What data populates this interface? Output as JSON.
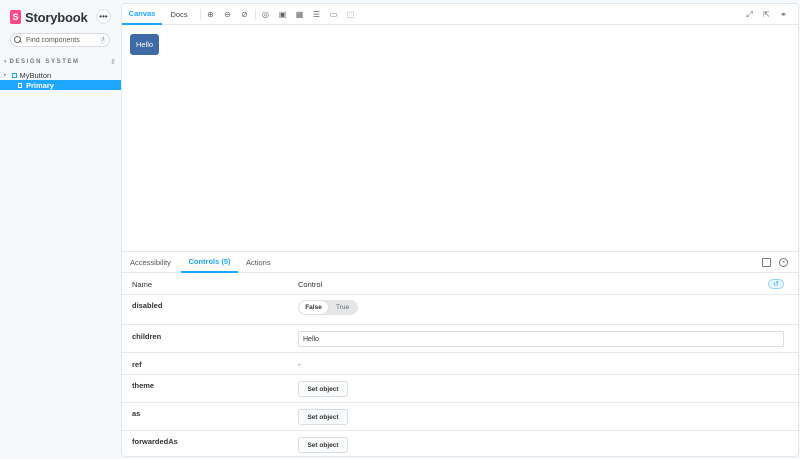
{
  "sidebar": {
    "brand": "Storybook",
    "logo_letter": "S",
    "menu_icon": "ellipsis-icon",
    "search": {
      "placeholder": "Find components",
      "shortcut": "/"
    },
    "group": {
      "label": "DESIGN SYSTEM"
    },
    "component": "MyButton",
    "story": "Primary",
    "accent": "#1ea7fd"
  },
  "toolbar": {
    "tabs": [
      {
        "label": "Canvas"
      },
      {
        "label": "Docs"
      }
    ],
    "icons": [
      "zoom-in-icon",
      "zoom-out-icon",
      "zoom-reset-icon",
      "grid-icon",
      "background-icon",
      "viewport-icon",
      "measure-icon",
      "outline-icon",
      "outline-frame-icon",
      "fullscreen-icon",
      "open-new-tab-icon",
      "link-icon"
    ]
  },
  "canvas": {
    "button_label": "Hello",
    "button_color": "#3e6ba5"
  },
  "addons": {
    "tabs": [
      {
        "label": "Accessibility"
      },
      {
        "label": "Controls (5)"
      },
      {
        "label": "Actions"
      }
    ],
    "table": {
      "headers": {
        "name": "Name",
        "control": "Control"
      },
      "rows": [
        {
          "name": "disabled",
          "toggle": {
            "off": "False",
            "on": "True"
          }
        },
        {
          "name": "children",
          "value": "Hello"
        },
        {
          "name": "ref",
          "value": "-"
        },
        {
          "name": "theme",
          "button": "Set object"
        },
        {
          "name": "as",
          "button": "Set object"
        },
        {
          "name": "forwardedAs",
          "button": "Set object"
        }
      ]
    }
  }
}
